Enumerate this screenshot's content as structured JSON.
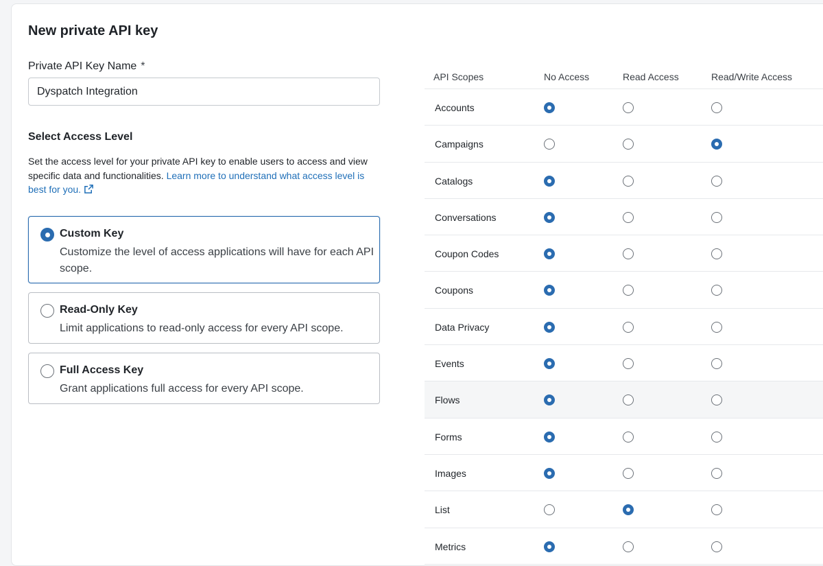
{
  "page": {
    "title": "New private API key"
  },
  "name_field": {
    "label": "Private API Key Name",
    "required_mark": "*",
    "value": "Dyspatch Integration"
  },
  "access_level": {
    "title": "Select Access Level",
    "description": "Set the access level for your private API key to enable users to access and view specific data and functionalities.",
    "learn_more_link": "Learn more to understand what access level is best for you.",
    "options": [
      {
        "title": "Custom Key",
        "description": "Customize the level of access applications will have for each API scope.",
        "selected": true
      },
      {
        "title": "Read-Only Key",
        "description": "Limit applications to read-only access for every API scope.",
        "selected": false
      },
      {
        "title": "Full Access Key",
        "description": "Grant applications full access for every API scope.",
        "selected": false
      }
    ]
  },
  "scopes_table": {
    "headers": [
      "API Scopes",
      "No Access",
      "Read Access",
      "Read/Write Access"
    ],
    "rows": [
      {
        "name": "Accounts",
        "access": "no"
      },
      {
        "name": "Campaigns",
        "access": "readwrite"
      },
      {
        "name": "Catalogs",
        "access": "no"
      },
      {
        "name": "Conversations",
        "access": "no"
      },
      {
        "name": "Coupon Codes",
        "access": "no"
      },
      {
        "name": "Coupons",
        "access": "no"
      },
      {
        "name": "Data Privacy",
        "access": "no"
      },
      {
        "name": "Events",
        "access": "no"
      },
      {
        "name": "Flows",
        "access": "no"
      },
      {
        "name": "Forms",
        "access": "no"
      },
      {
        "name": "Images",
        "access": "no"
      },
      {
        "name": "List",
        "access": "read"
      },
      {
        "name": "Metrics",
        "access": "no"
      }
    ]
  },
  "colors": {
    "accent": "#2b6cb0",
    "link": "#1f6fb8",
    "border": "#b9bdc3"
  }
}
